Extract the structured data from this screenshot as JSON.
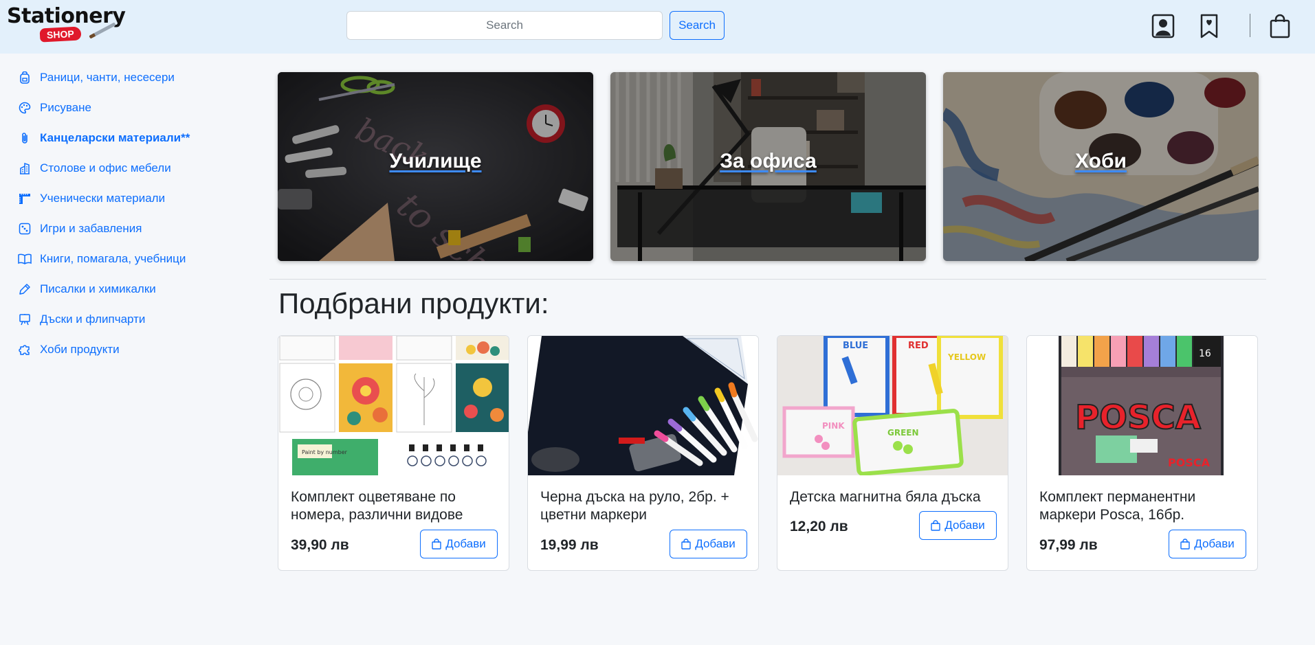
{
  "header": {
    "logo_text": "Stationery",
    "logo_badge": "SHOP",
    "search_placeholder": "Search",
    "search_button": "Search",
    "icons": [
      "user-icon",
      "bookmark-heart-icon",
      "shopping-bag-icon"
    ]
  },
  "sidebar": {
    "items": [
      {
        "label": "Раници, чанти, несесери",
        "icon": "backpack-icon"
      },
      {
        "label": "Рисуване",
        "icon": "palette-icon"
      },
      {
        "label": "Канцеларски материали**",
        "icon": "paperclip-icon",
        "active": true
      },
      {
        "label": "Столове и офис мебели",
        "icon": "building-icon"
      },
      {
        "label": "Ученически материали",
        "icon": "rulers-icon"
      },
      {
        "label": "Игри и забавления",
        "icon": "dice-icon"
      },
      {
        "label": "Книги, помагала, учебници",
        "icon": "book-icon"
      },
      {
        "label": "Писалки и химикалки",
        "icon": "pen-icon"
      },
      {
        "label": "Дъски и флипчарти",
        "icon": "easel-icon"
      },
      {
        "label": "Хоби продукти",
        "icon": "puzzle-icon"
      }
    ]
  },
  "categories": [
    {
      "title": "Училище"
    },
    {
      "title": "За офиса"
    },
    {
      "title": "Хоби"
    }
  ],
  "section_title": "Подбрани продукти:",
  "products": [
    {
      "name": "Комплект оцветяване по номера, различни видове",
      "price": "39,90 лв",
      "button": "Добави"
    },
    {
      "name": "Черна дъска на руло, 2бр. + цветни маркери",
      "price": "19,99 лв",
      "button": "Добави"
    },
    {
      "name": "Детска магнитна бяла дъска",
      "price": "12,20 лв",
      "button": "Добави"
    },
    {
      "name": "Комплект перманентни маркери Posca, 16бр.",
      "price": "97,99 лв",
      "button": "Добави"
    }
  ],
  "colors": {
    "primary": "#0d6efd",
    "header_bg": "#e3f0fb",
    "page_bg": "#f5f7fa",
    "logo_badge": "#e0192b"
  }
}
